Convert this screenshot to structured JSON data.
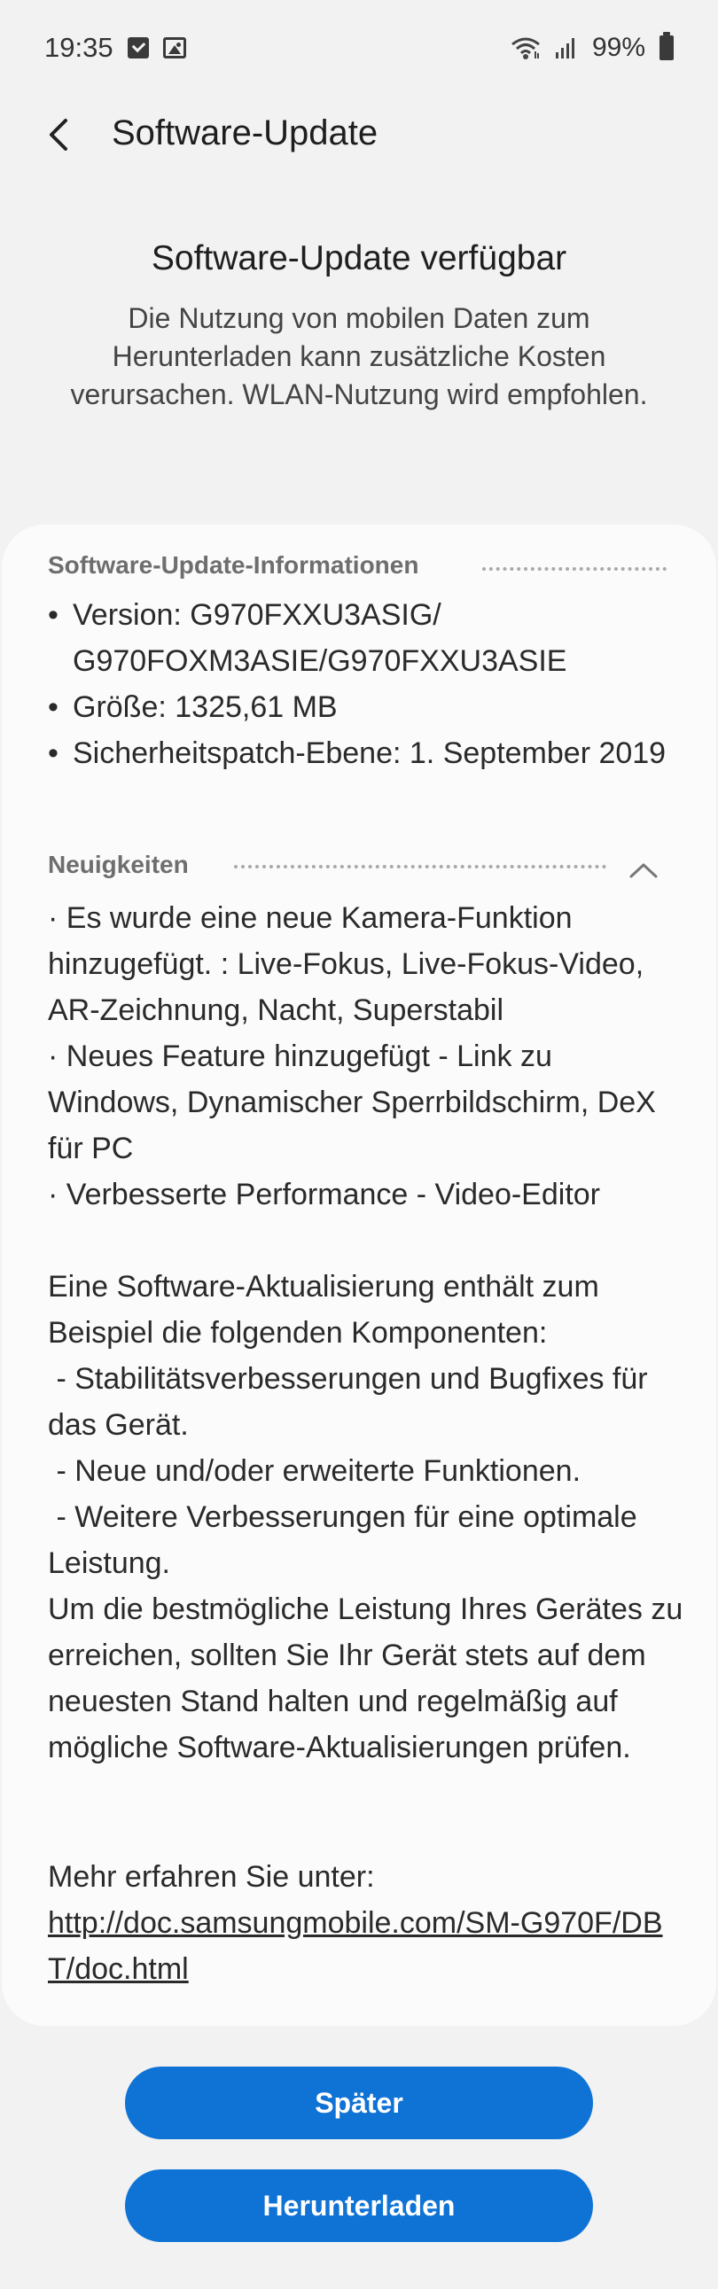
{
  "status_bar": {
    "time": "19:35",
    "icons": [
      "check-icon",
      "image-icon",
      "wifi-icon",
      "signal-icon",
      "battery-icon"
    ],
    "battery": "99%"
  },
  "header": {
    "back_icon": "chevron-left-icon",
    "title": "Software-Update"
  },
  "intro": {
    "title": "Software-Update verfügbar",
    "description": "Die Nutzung von mobilen Daten zum Herunterladen kann zusätzliche Kosten verursachen. WLAN-Nutzung wird empfohlen."
  },
  "info_section": {
    "title": "Software-Update-Informationen",
    "items": [
      "Version: G970FXXU3ASIG/ G970FOXM3ASIE/G970FXXU3ASIE",
      "Größe: 1325,61 MB",
      "Sicherheitspatch-Ebene: 1. September 2019"
    ]
  },
  "news_section": {
    "title": "Neuigkeiten",
    "collapse_icon": "chevron-up-icon",
    "text": "· Es wurde eine neue Kamera-Funktion hinzugefügt. : Live-Fokus, Live-Fokus-Video, AR-Zeichnung, Nacht, Superstabil\n· Neues Feature hinzugefügt - Link zu Windows, Dynamischer Sperrbildschirm, DeX für PC\n· Verbesserte Performance - Video-Editor\n\nEine Software-Aktualisierung enthält zum Beispiel die folgenden Komponenten:\n - Stabilitätsverbesserungen und Bugfixes für das Gerät.\n - Neue und/oder erweiterte Funktionen.\n - Weitere Verbesserungen für eine optimale Leistung.\nUm die bestmögliche Leistung Ihres Gerätes zu erreichen, sollten Sie Ihr Gerät stets auf dem neuesten Stand halten und regelmäßig auf mögliche Software-Aktualisierungen prüfen.",
    "more_label": "Mehr erfahren Sie unter:",
    "more_link": "http://doc.samsungmobile.com/SM-G970F/DBT/doc.html"
  },
  "buttons": {
    "later": "Später",
    "download": "Herunterladen"
  },
  "colors": {
    "accent": "#0f73d6",
    "background": "#f2f2f2",
    "card": "#fbfbfb"
  }
}
